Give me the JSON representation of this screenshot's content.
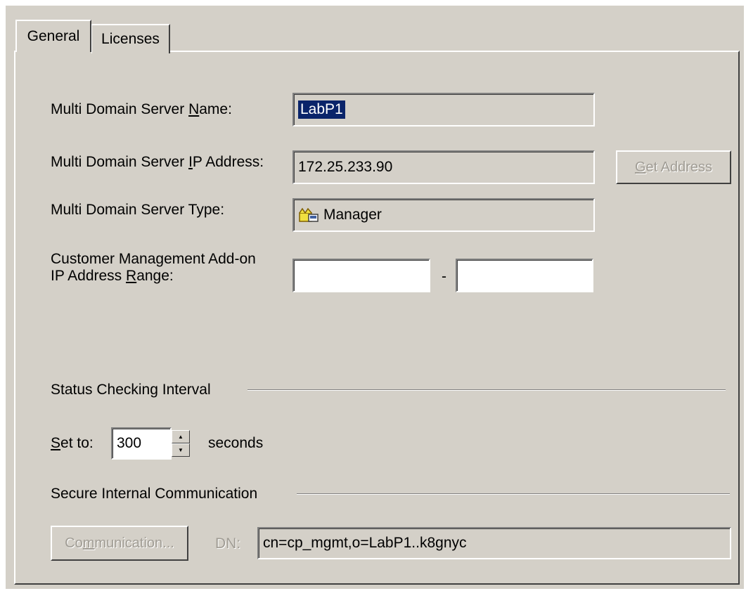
{
  "tabs": [
    {
      "label": "General",
      "active": true
    },
    {
      "label": "Licenses",
      "active": false
    }
  ],
  "server_name": {
    "label_pre": "Multi Domain Server ",
    "label_key": "N",
    "label_post": "ame:",
    "value": "LabP1"
  },
  "server_ip": {
    "label_pre": "Multi Domain Server ",
    "label_key": "I",
    "label_post": "P Address:",
    "value": "172.25.233.90",
    "button_key": "G",
    "button_rest": "et Address"
  },
  "server_type": {
    "label": "Multi Domain Server Type:",
    "value": "Manager",
    "icon": "crown-icon"
  },
  "cma_range": {
    "label_line1": "Customer Management Add-on",
    "label_line2_pre": "IP Address ",
    "label_line2_key": "R",
    "label_line2_post": "ange:",
    "from": "",
    "to": "",
    "separator": "-"
  },
  "status_interval": {
    "title": "Status Checking Interval",
    "set_key": "S",
    "set_rest": "et to:",
    "value": "300",
    "unit": "seconds"
  },
  "sic": {
    "title": "Secure Internal Communication",
    "button_pre": "Co",
    "button_key": "m",
    "button_post": "munication...",
    "dn_label": "DN:",
    "dn_value": "cn=cp_mgmt,o=LabP1..k8gnyc"
  },
  "colors": {
    "face": "#d4d0c8",
    "selection": "#0a246a",
    "disabled_text": "#a09c94"
  }
}
